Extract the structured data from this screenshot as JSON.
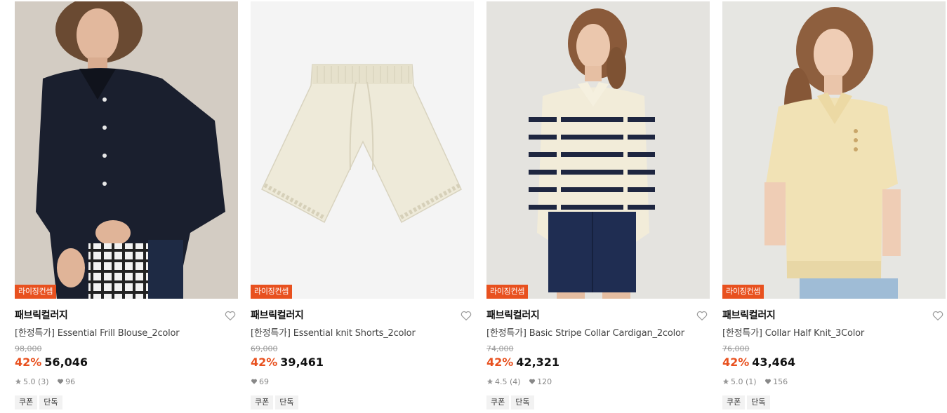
{
  "products": [
    {
      "badge": "라이징컨셉",
      "brand": "패브릭컬러지",
      "title": "[한정특가] Essential Frill Blouse_2color",
      "original_price": "98,000",
      "discount": "42%",
      "price": "56,046",
      "rating": "5.0",
      "reviews": "(3)",
      "likes": "96",
      "tags": [
        "쿠폰",
        "단독"
      ],
      "image": "model-black-blouse"
    },
    {
      "badge": "라이징컨셉",
      "brand": "패브릭컬러지",
      "title": "[한정특가] Essential knit Shorts_2color",
      "original_price": "69,000",
      "discount": "42%",
      "price": "39,461",
      "likes": "69",
      "tags": [
        "쿠폰",
        "단독"
      ],
      "image": "ivory-knit-shorts"
    },
    {
      "badge": "라이징컨셉",
      "brand": "패브릭컬러지",
      "title": "[한정특가] Basic Stripe Collar Cardigan_2color",
      "original_price": "74,000",
      "discount": "42%",
      "price": "42,321",
      "rating": "4.5",
      "reviews": "(4)",
      "likes": "120",
      "tags": [
        "쿠폰",
        "단독"
      ],
      "image": "model-stripe-cardigan"
    },
    {
      "badge": "라이징컨셉",
      "brand": "패브릭컬러지",
      "title": "[한정특가] Collar Half Knit_3Color",
      "original_price": "76,000",
      "discount": "42%",
      "price": "43,464",
      "rating": "5.0",
      "reviews": "(1)",
      "likes": "156",
      "tags": [
        "쿠폰",
        "단독"
      ],
      "image": "model-yellow-knit"
    }
  ],
  "colors": {
    "accent": "#e8511f",
    "tag_bg": "#f2f2f2",
    "muted": "#888888"
  },
  "icons": {
    "wishlist": "heart-outline-icon",
    "rating": "star-icon",
    "likes": "heart-filled-icon"
  }
}
